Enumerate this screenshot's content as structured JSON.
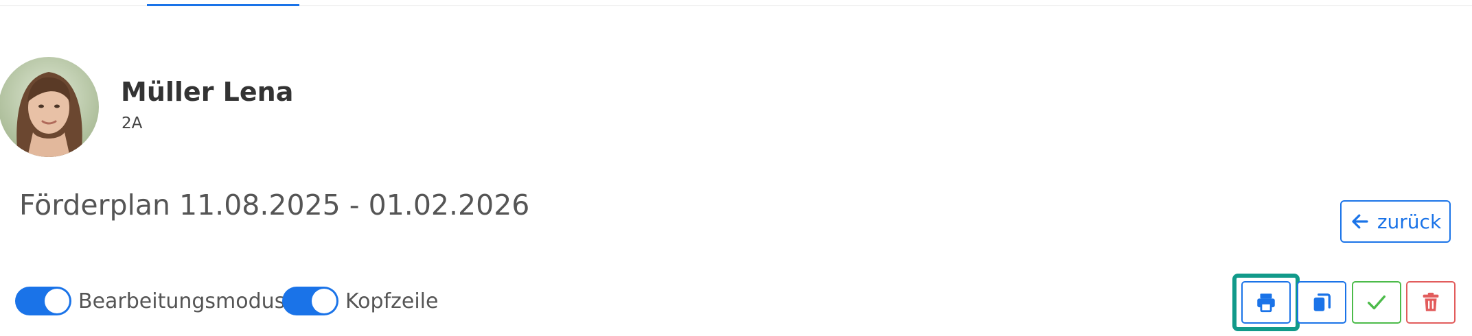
{
  "student": {
    "name": "Müller Lena",
    "class": "2A"
  },
  "plan": {
    "title": "Förderplan 11.08.2025 - 01.02.2026"
  },
  "navigation": {
    "back_label": "zurück"
  },
  "toggles": [
    {
      "label": "Bearbeitungsmodus",
      "state": "on"
    },
    {
      "label": "Kopfzeile",
      "state": "on"
    }
  ],
  "actions": [
    {
      "name": "print",
      "icon": "printer-icon",
      "color": "#1a73e8"
    },
    {
      "name": "copy",
      "icon": "copy-icon",
      "color": "#1a73e8"
    },
    {
      "name": "confirm",
      "icon": "check-icon",
      "color": "#4cbb4a"
    },
    {
      "name": "delete",
      "icon": "trash-icon",
      "color": "#e25c5c"
    }
  ],
  "colors": {
    "accent": "#1a73e8",
    "focus_ring": "#119a8a",
    "success": "#4cbb4a",
    "danger": "#e25c5c"
  }
}
